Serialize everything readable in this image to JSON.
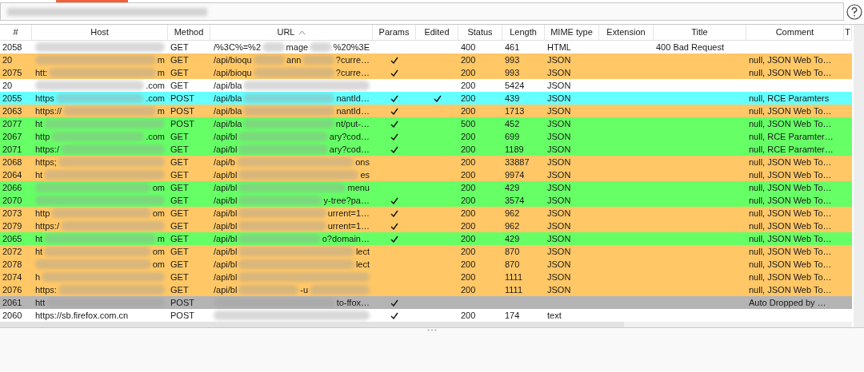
{
  "filter": {
    "redacted": true
  },
  "columns": [
    {
      "label": "#",
      "sorted": false
    },
    {
      "label": "Host",
      "sorted": false
    },
    {
      "label": "Method",
      "sorted": false
    },
    {
      "label": "URL",
      "sorted": true
    },
    {
      "label": "Params",
      "sorted": false
    },
    {
      "label": "Edited",
      "sorted": false
    },
    {
      "label": "Status",
      "sorted": false
    },
    {
      "label": "Length",
      "sorted": false
    },
    {
      "label": "MIME type",
      "sorted": false
    },
    {
      "label": "Extension",
      "sorted": false
    },
    {
      "label": "Title",
      "sorted": false
    },
    {
      "label": "Comment",
      "sorted": false
    },
    {
      "label": "T",
      "sorted": false
    }
  ],
  "rows": [
    {
      "number": "2058",
      "color": "#ffffff",
      "host": [
        {
          "kind": "redacted"
        }
      ],
      "method": "GET",
      "url": [
        {
          "kind": "text",
          "text": "/%3C%=%2"
        },
        {
          "kind": "redacted"
        },
        {
          "kind": "text",
          "text": "mage"
        },
        {
          "kind": "redacted"
        },
        {
          "kind": "text",
          "text": "%20%3E"
        }
      ],
      "params": false,
      "edited": false,
      "status": "400",
      "length": "461",
      "mime": "HTML",
      "title": "400 Bad Request"
    },
    {
      "number": "20",
      "color": "#ffc766",
      "host": [
        {
          "kind": "redacted"
        },
        {
          "kind": "text",
          "text": "m"
        }
      ],
      "method": "GET",
      "url": [
        {
          "kind": "text",
          "text": "/api/bioqu"
        },
        {
          "kind": "redacted"
        },
        {
          "kind": "text",
          "text": "ann"
        },
        {
          "kind": "redacted"
        },
        {
          "kind": "text",
          "text": "?curre…"
        }
      ],
      "params": true,
      "edited": false,
      "status": "200",
      "length": "993",
      "mime": "JSON",
      "comment": "null, JSON Web To…"
    },
    {
      "number": "2075",
      "color": "#ffc766",
      "host": [
        {
          "kind": "text",
          "text": "htt:"
        },
        {
          "kind": "redacted"
        },
        {
          "kind": "text",
          "text": "m"
        }
      ],
      "method": "GET",
      "url": [
        {
          "kind": "text",
          "text": "/api/bioqu"
        },
        {
          "kind": "redacted"
        },
        {
          "kind": "text",
          "text": "?curre…"
        }
      ],
      "params": true,
      "edited": false,
      "status": "200",
      "length": "993",
      "mime": "JSON",
      "comment": "null, JSON Web To…"
    },
    {
      "number": "20",
      "color": "#ffffff",
      "host": [
        {
          "kind": "redacted"
        },
        {
          "kind": "text",
          "text": ".com"
        }
      ],
      "method": "GET",
      "url": [
        {
          "kind": "text",
          "text": "/api/bla"
        },
        {
          "kind": "redacted"
        }
      ],
      "params": false,
      "edited": false,
      "status": "200",
      "length": "5424",
      "mime": "JSON"
    },
    {
      "number": "2055",
      "color": "#66ffff",
      "host": [
        {
          "kind": "text",
          "text": "https"
        },
        {
          "kind": "redacted"
        },
        {
          "kind": "text",
          "text": ".com"
        }
      ],
      "method": "POST",
      "url": [
        {
          "kind": "text",
          "text": "/api/bla"
        },
        {
          "kind": "redacted"
        },
        {
          "kind": "text",
          "text": "nantId…"
        }
      ],
      "params": true,
      "edited": true,
      "status": "200",
      "length": "439",
      "mime": "JSON",
      "comment": "null, RCE Paramters"
    },
    {
      "number": "2063",
      "color": "#ffc766",
      "host": [
        {
          "kind": "text",
          "text": "https://"
        },
        {
          "kind": "redacted"
        },
        {
          "kind": "text",
          "text": "m"
        }
      ],
      "method": "POST",
      "url": [
        {
          "kind": "text",
          "text": "/api/bla"
        },
        {
          "kind": "redacted"
        },
        {
          "kind": "text",
          "text": "nantId…"
        }
      ],
      "params": true,
      "edited": false,
      "status": "200",
      "length": "1713",
      "mime": "JSON",
      "comment": "null, JSON Web To…"
    },
    {
      "number": "2077",
      "color": "#66ff66",
      "host": [
        {
          "kind": "text",
          "text": "ht"
        },
        {
          "kind": "redacted"
        }
      ],
      "method": "POST",
      "url": [
        {
          "kind": "text",
          "text": "/api/bla"
        },
        {
          "kind": "redacted"
        },
        {
          "kind": "text",
          "text": "nt/put-…"
        }
      ],
      "params": true,
      "edited": false,
      "status": "500",
      "length": "452",
      "mime": "JSON",
      "comment": "null, JSON Web To…"
    },
    {
      "number": "2067",
      "color": "#66ff66",
      "host": [
        {
          "kind": "text",
          "text": "http"
        },
        {
          "kind": "redacted"
        },
        {
          "kind": "text",
          "text": ".com"
        }
      ],
      "method": "GET",
      "url": [
        {
          "kind": "text",
          "text": "/api/bl"
        },
        {
          "kind": "redacted"
        },
        {
          "kind": "text",
          "text": "ary?cod…"
        }
      ],
      "params": true,
      "edited": false,
      "status": "200",
      "length": "699",
      "mime": "JSON",
      "comment": "null, RCE Paramter…"
    },
    {
      "number": "2071",
      "color": "#66ff66",
      "host": [
        {
          "kind": "text",
          "text": "https:/"
        },
        {
          "kind": "redacted"
        }
      ],
      "method": "GET",
      "url": [
        {
          "kind": "text",
          "text": "/api/bl"
        },
        {
          "kind": "redacted"
        },
        {
          "kind": "text",
          "text": "ary?cod…"
        }
      ],
      "params": true,
      "edited": false,
      "status": "200",
      "length": "1189",
      "mime": "JSON",
      "comment": "null, RCE Paramter…"
    },
    {
      "number": "2068",
      "color": "#ffc766",
      "host": [
        {
          "kind": "text",
          "text": "https;"
        },
        {
          "kind": "redacted"
        }
      ],
      "method": "GET",
      "url": [
        {
          "kind": "text",
          "text": "/api/b"
        },
        {
          "kind": "redacted"
        },
        {
          "kind": "text",
          "text": "ons"
        }
      ],
      "params": false,
      "edited": false,
      "status": "200",
      "length": "33887",
      "mime": "JSON",
      "comment": "null, JSON Web To…"
    },
    {
      "number": "2064",
      "color": "#ffc766",
      "host": [
        {
          "kind": "text",
          "text": "ht"
        },
        {
          "kind": "redacted"
        }
      ],
      "method": "GET",
      "url": [
        {
          "kind": "text",
          "text": "/api/bl"
        },
        {
          "kind": "redacted"
        },
        {
          "kind": "text",
          "text": "es"
        }
      ],
      "params": false,
      "edited": false,
      "status": "200",
      "length": "9974",
      "mime": "JSON",
      "comment": "null, JSON Web To…"
    },
    {
      "number": "2066",
      "color": "#66ff66",
      "host": [
        {
          "kind": "redacted"
        },
        {
          "kind": "text",
          "text": "om"
        }
      ],
      "method": "GET",
      "url": [
        {
          "kind": "text",
          "text": "/api/bl"
        },
        {
          "kind": "redacted"
        },
        {
          "kind": "text",
          "text": "menu"
        }
      ],
      "params": false,
      "edited": false,
      "status": "200",
      "length": "429",
      "mime": "JSON",
      "comment": "null, JSON Web To…"
    },
    {
      "number": "2070",
      "color": "#66ff66",
      "host": [
        {
          "kind": "redacted"
        }
      ],
      "method": "GET",
      "url": [
        {
          "kind": "text",
          "text": "/api/bl"
        },
        {
          "kind": "redacted"
        },
        {
          "kind": "text",
          "text": "y-tree?pa…"
        }
      ],
      "params": true,
      "edited": false,
      "status": "200",
      "length": "3574",
      "mime": "JSON",
      "comment": "null, JSON Web To…"
    },
    {
      "number": "2073",
      "color": "#ffc766",
      "host": [
        {
          "kind": "text",
          "text": "http"
        },
        {
          "kind": "redacted"
        },
        {
          "kind": "text",
          "text": "om"
        }
      ],
      "method": "GET",
      "url": [
        {
          "kind": "text",
          "text": "/api/bl"
        },
        {
          "kind": "redacted"
        },
        {
          "kind": "text",
          "text": "urrent=1…"
        }
      ],
      "params": true,
      "edited": false,
      "status": "200",
      "length": "962",
      "mime": "JSON",
      "comment": "null, JSON Web To…"
    },
    {
      "number": "2079",
      "color": "#ffc766",
      "host": [
        {
          "kind": "text",
          "text": "https:/"
        },
        {
          "kind": "redacted"
        }
      ],
      "method": "GET",
      "url": [
        {
          "kind": "text",
          "text": "/api/bl"
        },
        {
          "kind": "redacted"
        },
        {
          "kind": "text",
          "text": "urrent=1…"
        }
      ],
      "params": true,
      "edited": false,
      "status": "200",
      "length": "962",
      "mime": "JSON",
      "comment": "null, JSON Web To…"
    },
    {
      "number": "2065",
      "color": "#66ff66",
      "host": [
        {
          "kind": "text",
          "text": "ht"
        },
        {
          "kind": "redacted"
        },
        {
          "kind": "text",
          "text": "m"
        }
      ],
      "method": "GET",
      "url": [
        {
          "kind": "text",
          "text": "/api/bl"
        },
        {
          "kind": "redacted"
        },
        {
          "kind": "text",
          "text": "o?domain…"
        }
      ],
      "params": true,
      "edited": false,
      "status": "200",
      "length": "429",
      "mime": "JSON",
      "comment": "null, JSON Web To…"
    },
    {
      "number": "2072",
      "color": "#ffc766",
      "host": [
        {
          "kind": "text",
          "text": "ht"
        },
        {
          "kind": "redacted"
        },
        {
          "kind": "text",
          "text": "om"
        }
      ],
      "method": "GET",
      "url": [
        {
          "kind": "text",
          "text": "/api/bl"
        },
        {
          "kind": "redacted"
        },
        {
          "kind": "text",
          "text": "lect"
        }
      ],
      "params": false,
      "edited": false,
      "status": "200",
      "length": "870",
      "mime": "JSON",
      "comment": "null, JSON Web To…"
    },
    {
      "number": "2078",
      "color": "#ffc766",
      "host": [
        {
          "kind": "redacted"
        },
        {
          "kind": "text",
          "text": "om"
        }
      ],
      "method": "GET",
      "url": [
        {
          "kind": "text",
          "text": "/api/bl"
        },
        {
          "kind": "redacted"
        },
        {
          "kind": "text",
          "text": "lect"
        }
      ],
      "params": false,
      "edited": false,
      "status": "200",
      "length": "870",
      "mime": "JSON",
      "comment": "null, JSON Web To…"
    },
    {
      "number": "2074",
      "color": "#ffc766",
      "host": [
        {
          "kind": "text",
          "text": "h"
        },
        {
          "kind": "redacted"
        }
      ],
      "method": "GET",
      "url": [
        {
          "kind": "text",
          "text": "/api/bl"
        },
        {
          "kind": "redacted"
        }
      ],
      "params": false,
      "edited": false,
      "status": "200",
      "length": "1111",
      "mime": "JSON",
      "comment": "null, JSON Web To…"
    },
    {
      "number": "2076",
      "color": "#ffc766",
      "host": [
        {
          "kind": "text",
          "text": "https:"
        },
        {
          "kind": "redacted"
        }
      ],
      "method": "GET",
      "url": [
        {
          "kind": "text",
          "text": "/api/bl"
        },
        {
          "kind": "redacted"
        },
        {
          "kind": "text",
          "text": "-u"
        },
        {
          "kind": "redacted"
        }
      ],
      "params": false,
      "edited": false,
      "status": "200",
      "length": "1111",
      "mime": "JSON",
      "comment": "null, JSON Web To…"
    },
    {
      "number": "2061",
      "color": "#b4b4b4",
      "host": [
        {
          "kind": "text",
          "text": "htt"
        },
        {
          "kind": "redacted"
        }
      ],
      "method": "POST",
      "url": [
        {
          "kind": "redacted"
        },
        {
          "kind": "text",
          "text": "to-ffox…"
        }
      ],
      "params": true,
      "edited": false,
      "comment": "Auto Dropped by …"
    },
    {
      "number": "2060",
      "color": "#ffffff",
      "host": [
        {
          "kind": "text",
          "text": "https://sb.firefox.com.cn"
        }
      ],
      "method": "POST",
      "url": [
        {
          "kind": "redacted"
        }
      ],
      "params": true,
      "edited": false,
      "status": "200",
      "length": "174",
      "mime": "text"
    }
  ]
}
